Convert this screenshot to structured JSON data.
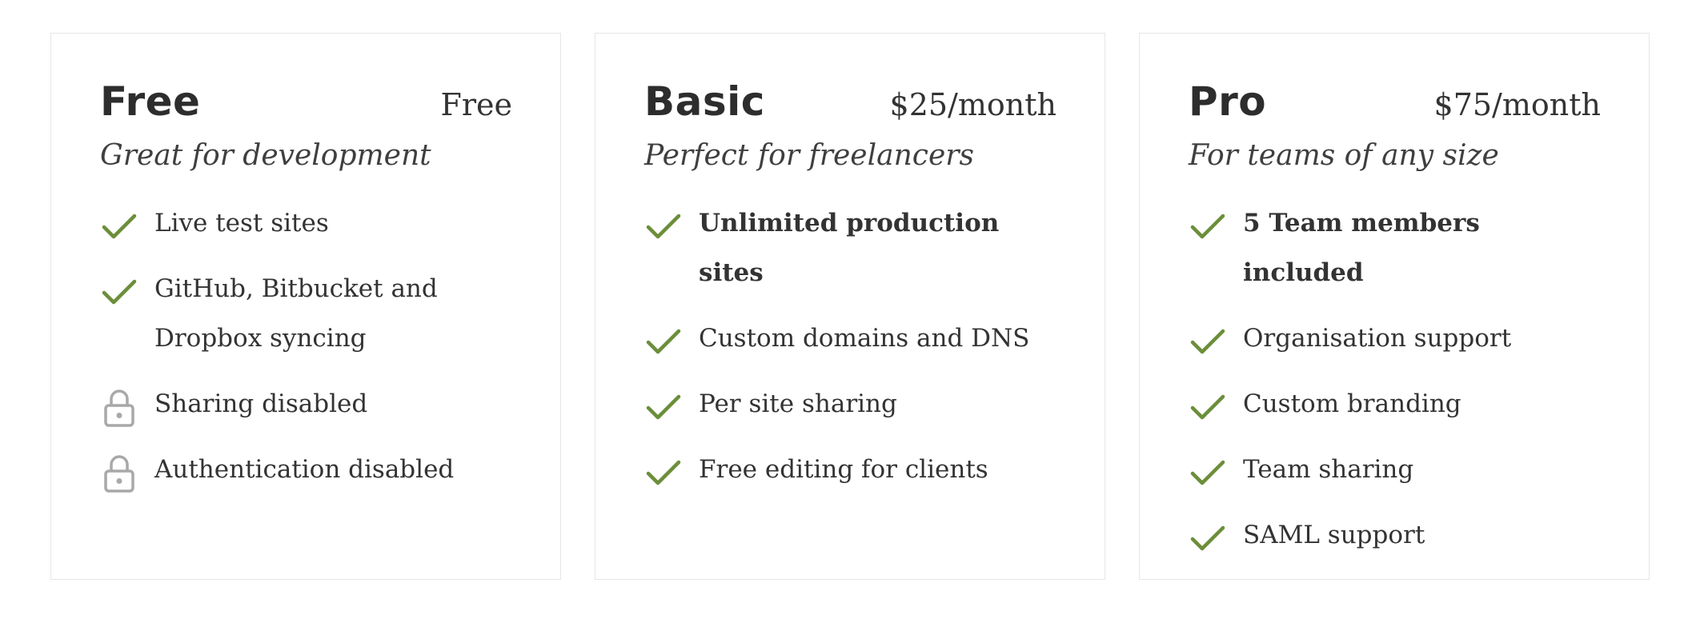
{
  "plans": [
    {
      "name": "Free",
      "price": "Free",
      "tagline": "Great for development",
      "features": [
        {
          "label": "Live test sites",
          "icon": "check-icon",
          "bold": false
        },
        {
          "label": "GitHub, Bitbucket and Dropbox syncing",
          "icon": "check-icon",
          "bold": false
        },
        {
          "label": "Sharing disabled",
          "icon": "lock-icon",
          "bold": false
        },
        {
          "label": "Authentication disabled",
          "icon": "lock-icon",
          "bold": false
        }
      ]
    },
    {
      "name": "Basic",
      "price": "$25/month",
      "tagline": "Perfect for freelancers",
      "features": [
        {
          "label": "Unlimited production sites",
          "icon": "check-icon",
          "bold": true
        },
        {
          "label": "Custom domains and DNS",
          "icon": "check-icon",
          "bold": false
        },
        {
          "label": "Per site sharing",
          "icon": "check-icon",
          "bold": false
        },
        {
          "label": "Free editing for clients",
          "icon": "check-icon",
          "bold": false
        }
      ]
    },
    {
      "name": "Pro",
      "price": "$75/month",
      "tagline": "For teams of any size",
      "features": [
        {
          "label": "5 Team members included",
          "icon": "check-icon",
          "bold": true
        },
        {
          "label": "Organisation support",
          "icon": "check-icon",
          "bold": false
        },
        {
          "label": "Custom branding",
          "icon": "check-icon",
          "bold": false
        },
        {
          "label": "Team sharing",
          "icon": "check-icon",
          "bold": false
        },
        {
          "label": "SAML support",
          "icon": "check-icon",
          "bold": false
        }
      ]
    }
  ],
  "colors": {
    "check": "#6b8e3a",
    "lock": "#a8a8a8",
    "border": "#e6e6e6"
  }
}
